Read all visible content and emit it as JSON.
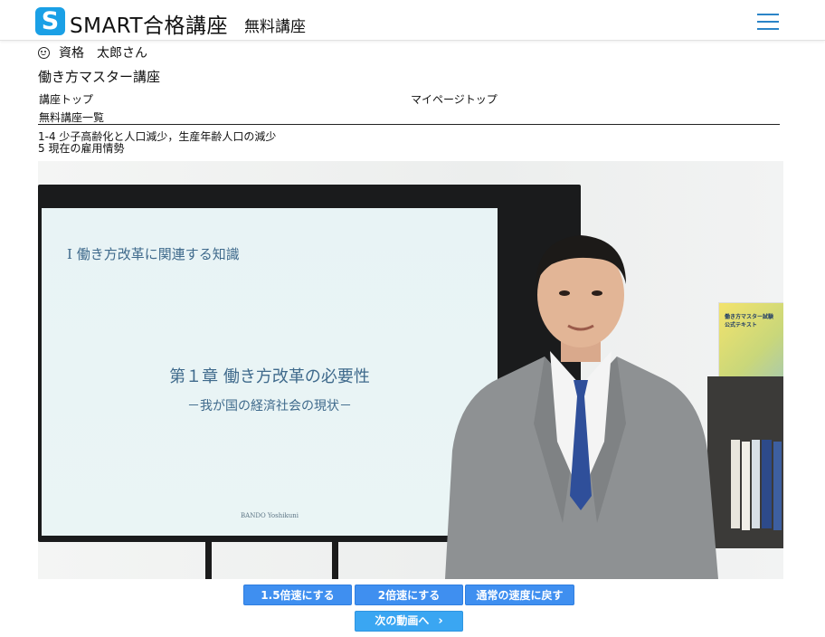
{
  "header": {
    "logo_letter": "S",
    "brand": "SMART合格講座",
    "sub": "無料講座",
    "menu_icon": "hamburger-icon"
  },
  "user": {
    "name": "資格　太郎さん",
    "icon": "smiley-icon"
  },
  "course": {
    "title": "働き方マスター講座",
    "links": {
      "course_top": "講座トップ",
      "mypage_top": "マイページトップ",
      "free_list": "無料講座一覧"
    }
  },
  "lesson": {
    "line1": "1-4 少子高齢化と人口減少，生産年齢人口の減少",
    "line2": "5 現在の雇用情勢"
  },
  "video": {
    "slide_heading": "Ⅰ 働き方改革に関連する知識",
    "slide_chapter": "第１章 働き方改革の必要性",
    "slide_subtitle": "－我が国の経済社会の現状－",
    "slide_author": "BANDO Yoshikuni",
    "book_title": "働き方マスター試験\n公式テキスト"
  },
  "controls": {
    "speed_15": "1.5倍速にする",
    "speed_2": "2倍速にする",
    "speed_normal": "通常の速度に戻す",
    "next": "次の動画へ"
  },
  "colors": {
    "accent": "#3f8ff0",
    "logo": "#1aa0e6",
    "menu": "#2b84c7"
  }
}
